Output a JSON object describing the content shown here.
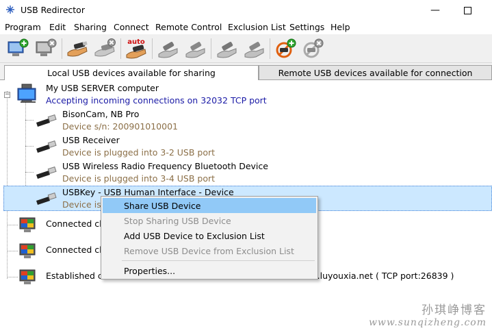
{
  "window": {
    "title": "USB Redirector"
  },
  "menu": [
    "Program",
    "Edit",
    "Sharing",
    "Connect",
    "Remote Control",
    "Exclusion List",
    "Settings",
    "Help"
  ],
  "toolbar": {
    "buttons": [
      "add-server-icon",
      "remove-server-icon",
      "share-device-icon",
      "unshare-device-icon",
      "auto-share-icon",
      "connect-device-icon",
      "disconnect-device-icon",
      "connect-remote-icon",
      "disconnect-remote-icon",
      "add-exclusion-icon",
      "remove-exclusion-icon"
    ],
    "auto_label": "auto"
  },
  "tabs": {
    "local": "Local USB devices available for sharing",
    "remote": "Remote USB devices available for connection"
  },
  "tree": {
    "server": {
      "title": "My USB SERVER computer",
      "status": "Accepting incoming connections on 32032 TCP port"
    },
    "devices": [
      {
        "name": "BisonCam, NB Pro",
        "detail": "Device s/n: 200901010001"
      },
      {
        "name": "USB Receiver",
        "detail": "Device is plugged into 3-2 USB port"
      },
      {
        "name": "USB Wireless Radio Frequency Bluetooth Device",
        "detail": "Device is plugged into 3-4 USB port"
      },
      {
        "name": "USBKey - USB Human Interface - Device",
        "detail": "Device is"
      }
    ],
    "clients": [
      {
        "label": "Connected cli"
      },
      {
        "label": "Connected cli"
      },
      {
        "label": "Established ca",
        "label_tail": "e1.luyouxia.net ( TCP port:26839 )"
      }
    ]
  },
  "context_menu": {
    "items": [
      {
        "label": "Share USB Device",
        "state": "highlighted"
      },
      {
        "label": "Stop Sharing USB Device",
        "state": "disabled"
      },
      {
        "label": "Add USB Device to Exclusion List",
        "state": "enabled"
      },
      {
        "label": "Remove USB Device from Exclusion List",
        "state": "disabled"
      },
      {
        "label": "Properties...",
        "state": "enabled"
      }
    ]
  },
  "watermark": {
    "cn": "孙琪峥博客",
    "url": "www.sunqizheng.com"
  },
  "colors": {
    "accent_blue": "#1a1aa6",
    "detail_brown": "#8b6f47",
    "selection": "#cce8ff",
    "menu_highlight": "#91c9f7"
  }
}
